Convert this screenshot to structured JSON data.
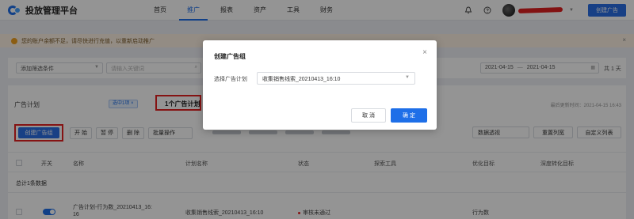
{
  "app": {
    "title": "投放管理平台"
  },
  "nav": {
    "items": [
      "首页",
      "推广",
      "报表",
      "资产",
      "工具",
      "财务"
    ],
    "active": "推广"
  },
  "header": {
    "create_ad_label": "创建广告"
  },
  "notice": {
    "text": "您的账户余额不足，请尽快进行充值，以重新启动推广"
  },
  "filters": {
    "add_filter_label": "添加筛选条件",
    "search_placeholder": "请输入关键词",
    "date_start": "2021-04-15",
    "date_sep": "—",
    "date_end": "2021-04-15",
    "days": "共 1 天"
  },
  "panel": {
    "title": "广告计划",
    "selected_tag": "选中1项 ×",
    "count_text": "1个广告计划",
    "update_time": "最后更新时间：2021-04-15 16:43"
  },
  "toolbar": {
    "create_group_label": "创建广告组",
    "start_label": "开 始",
    "pause_label": "暂 停",
    "delete_label": "删 除",
    "batch_label": "批量操作",
    "data_perspective_label": "数据透视",
    "reset_columns_label": "重置列宽",
    "custom_columns_label": "自定义列表"
  },
  "table": {
    "headers": [
      "开关",
      "名称",
      "计划名称",
      "状态",
      "探索工具",
      "优化目标",
      "深度转化目标"
    ],
    "summary_label": "总计1条数据",
    "row": {
      "name_line1": "广告计划-行为数_20210413_16:",
      "name_line2": "16",
      "plan_name": "收集销售线索_20210413_16:10",
      "status": "审核未通过",
      "optimize_target": "行为数"
    }
  },
  "modal": {
    "title": "创建广告组",
    "field_label": "选择广告计划",
    "field_value": "收集销售线索_20210413_16:10",
    "cancel_label": "取 消",
    "ok_label": "确 定"
  },
  "colors": {
    "primary": "#1e6fe8",
    "highlight": "#e52222",
    "warning": "#f0a020"
  }
}
